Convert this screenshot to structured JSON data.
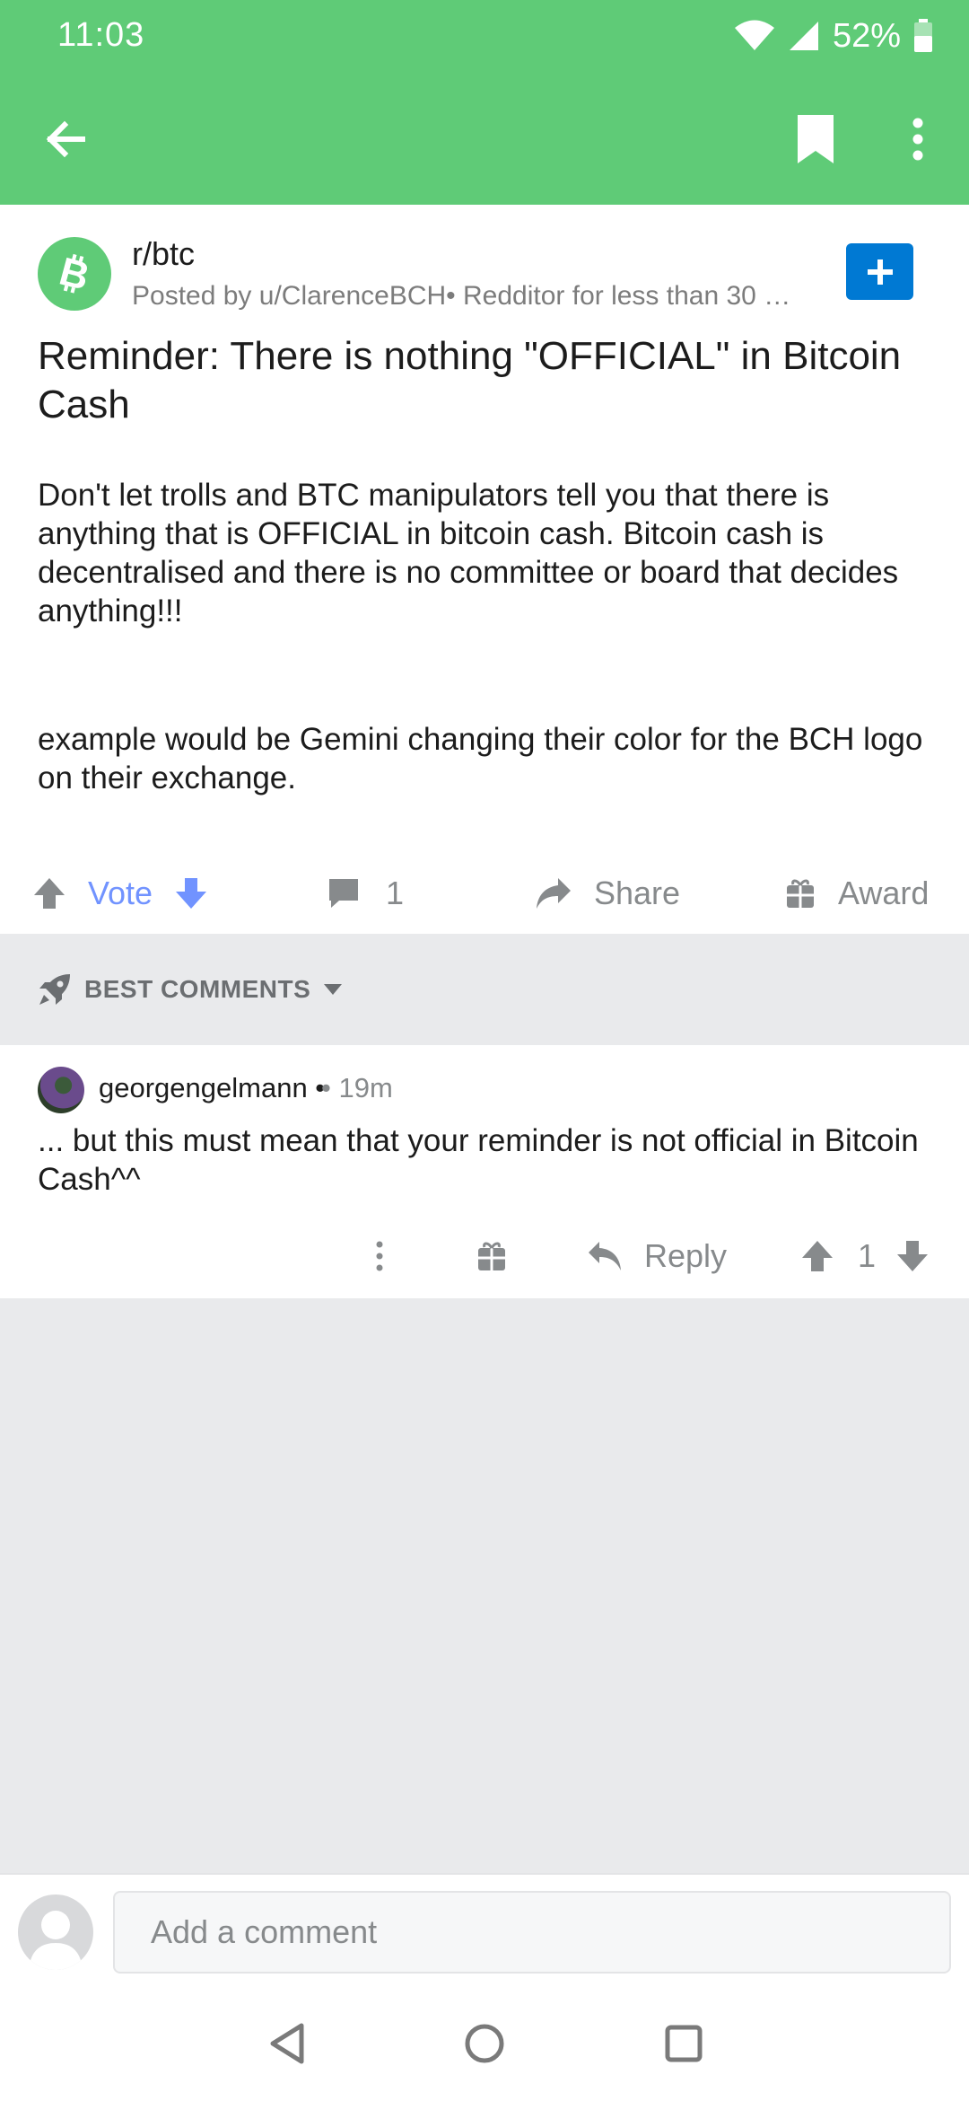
{
  "status_bar": {
    "time": "11:03",
    "battery": "52%"
  },
  "toolbar": {
    "back_icon": "arrow-left-icon",
    "bookmark_icon": "bookmark-icon",
    "more_icon": "more-vertical-icon"
  },
  "post": {
    "subreddit": "r/btc",
    "meta": "Posted by u/ClarenceBCH• Redditor for less than 30 …",
    "title": "Reminder: There is nothing \"OFFICIAL\" in Bitcoin Cash",
    "body": [
      "Don't let trolls and BTC manipulators tell you that there is anything that is OFFICIAL in bitcoin cash. Bitcoin cash is decentralised and there is no committee or board that decides anything!!!",
      "example would be Gemini changing their color for the BCH logo on their exchange."
    ],
    "actions": {
      "vote": "Vote",
      "comments": "1",
      "share": "Share",
      "award": "Award"
    },
    "colors": {
      "vote_accent": "#7193ff",
      "brand_green": "#5fcb77",
      "join_blue": "#0079d3"
    }
  },
  "sort": {
    "label": "BEST COMMENTS"
  },
  "comment": {
    "author": "georgengelmann •",
    "time": "• 19m",
    "body": "... but this must mean that your reminder is not official in Bitcoin Cash^^",
    "reply_label": "Reply",
    "score": "1"
  },
  "compose": {
    "placeholder": "Add a comment"
  }
}
